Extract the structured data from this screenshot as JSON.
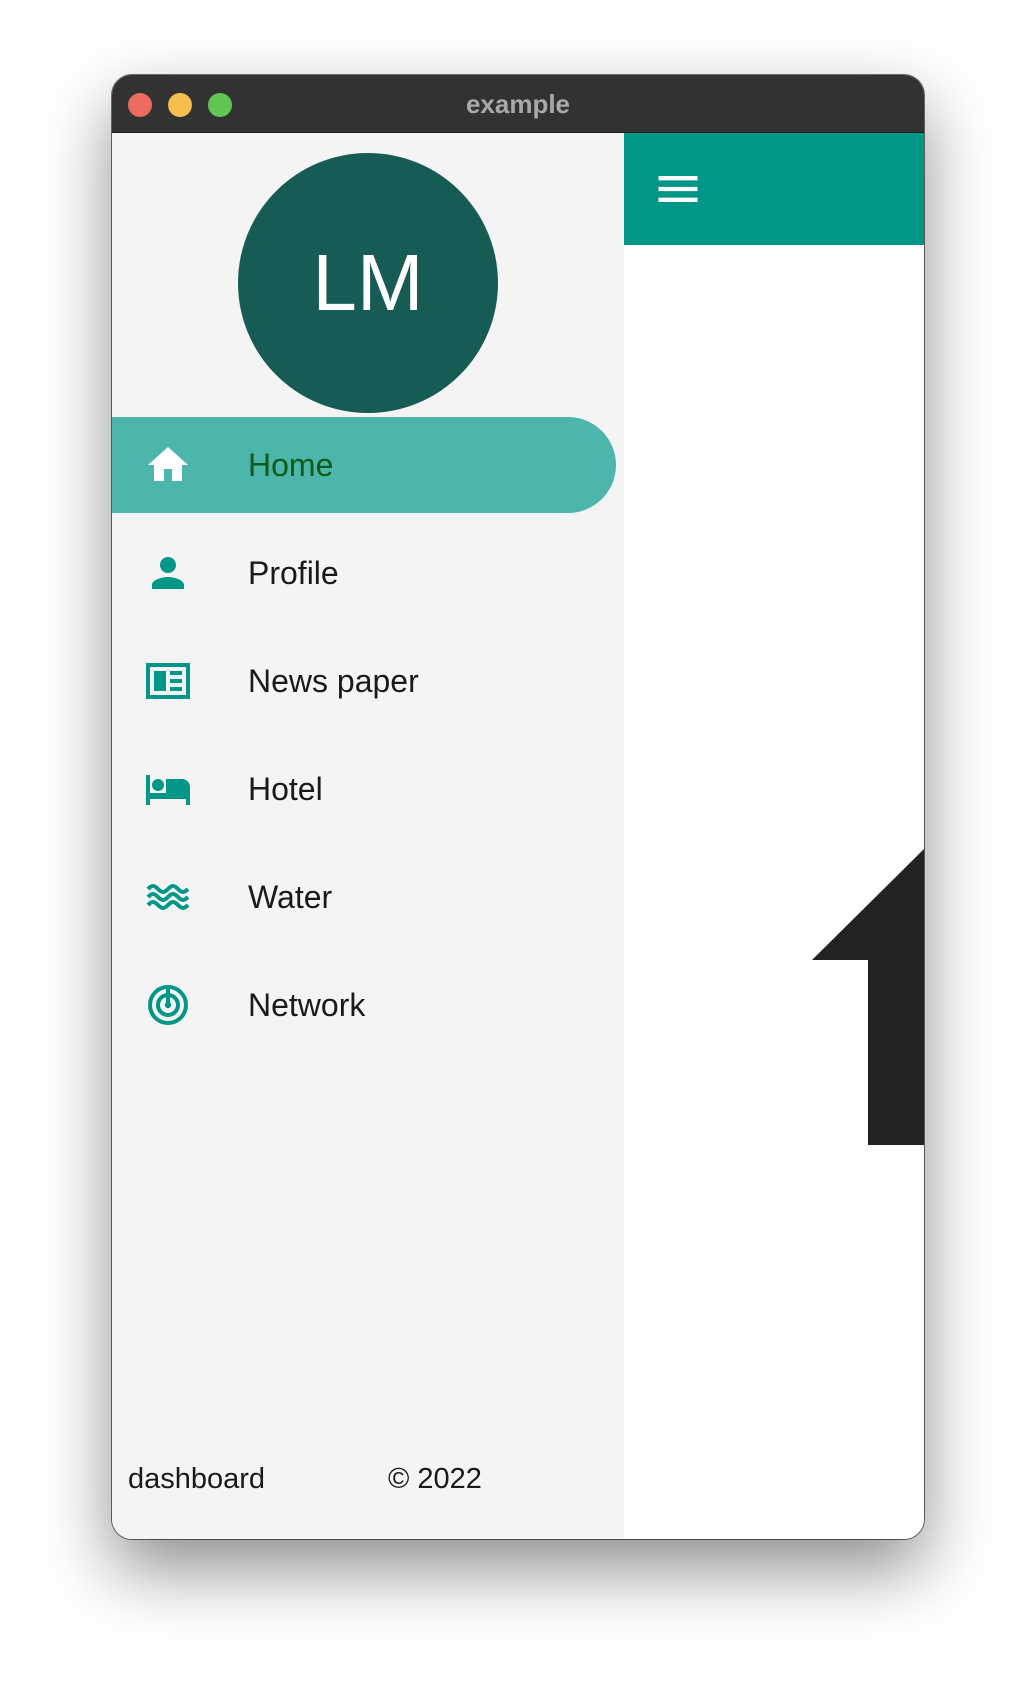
{
  "window": {
    "title": "example"
  },
  "drawer": {
    "avatar_initials": "LM",
    "items": [
      {
        "label": "Home",
        "icon": "home-icon",
        "active": true
      },
      {
        "label": "Profile",
        "icon": "person-icon",
        "active": false
      },
      {
        "label": "News paper",
        "icon": "newspaper-icon",
        "active": false
      },
      {
        "label": "Hotel",
        "icon": "hotel-icon",
        "active": false
      },
      {
        "label": "Water",
        "icon": "water-icon",
        "active": false
      },
      {
        "label": "Network",
        "icon": "network-icon",
        "active": false
      }
    ],
    "footer": {
      "left": "dashboard",
      "right": "© 2022"
    }
  },
  "appbar": {
    "menu_icon": "menu-icon"
  },
  "colors": {
    "primary": "#009688",
    "active_item": "#4db6ac",
    "avatar": "#175b55",
    "active_label": "#0e5a16",
    "drawer_bg": "#f4f4f4"
  }
}
